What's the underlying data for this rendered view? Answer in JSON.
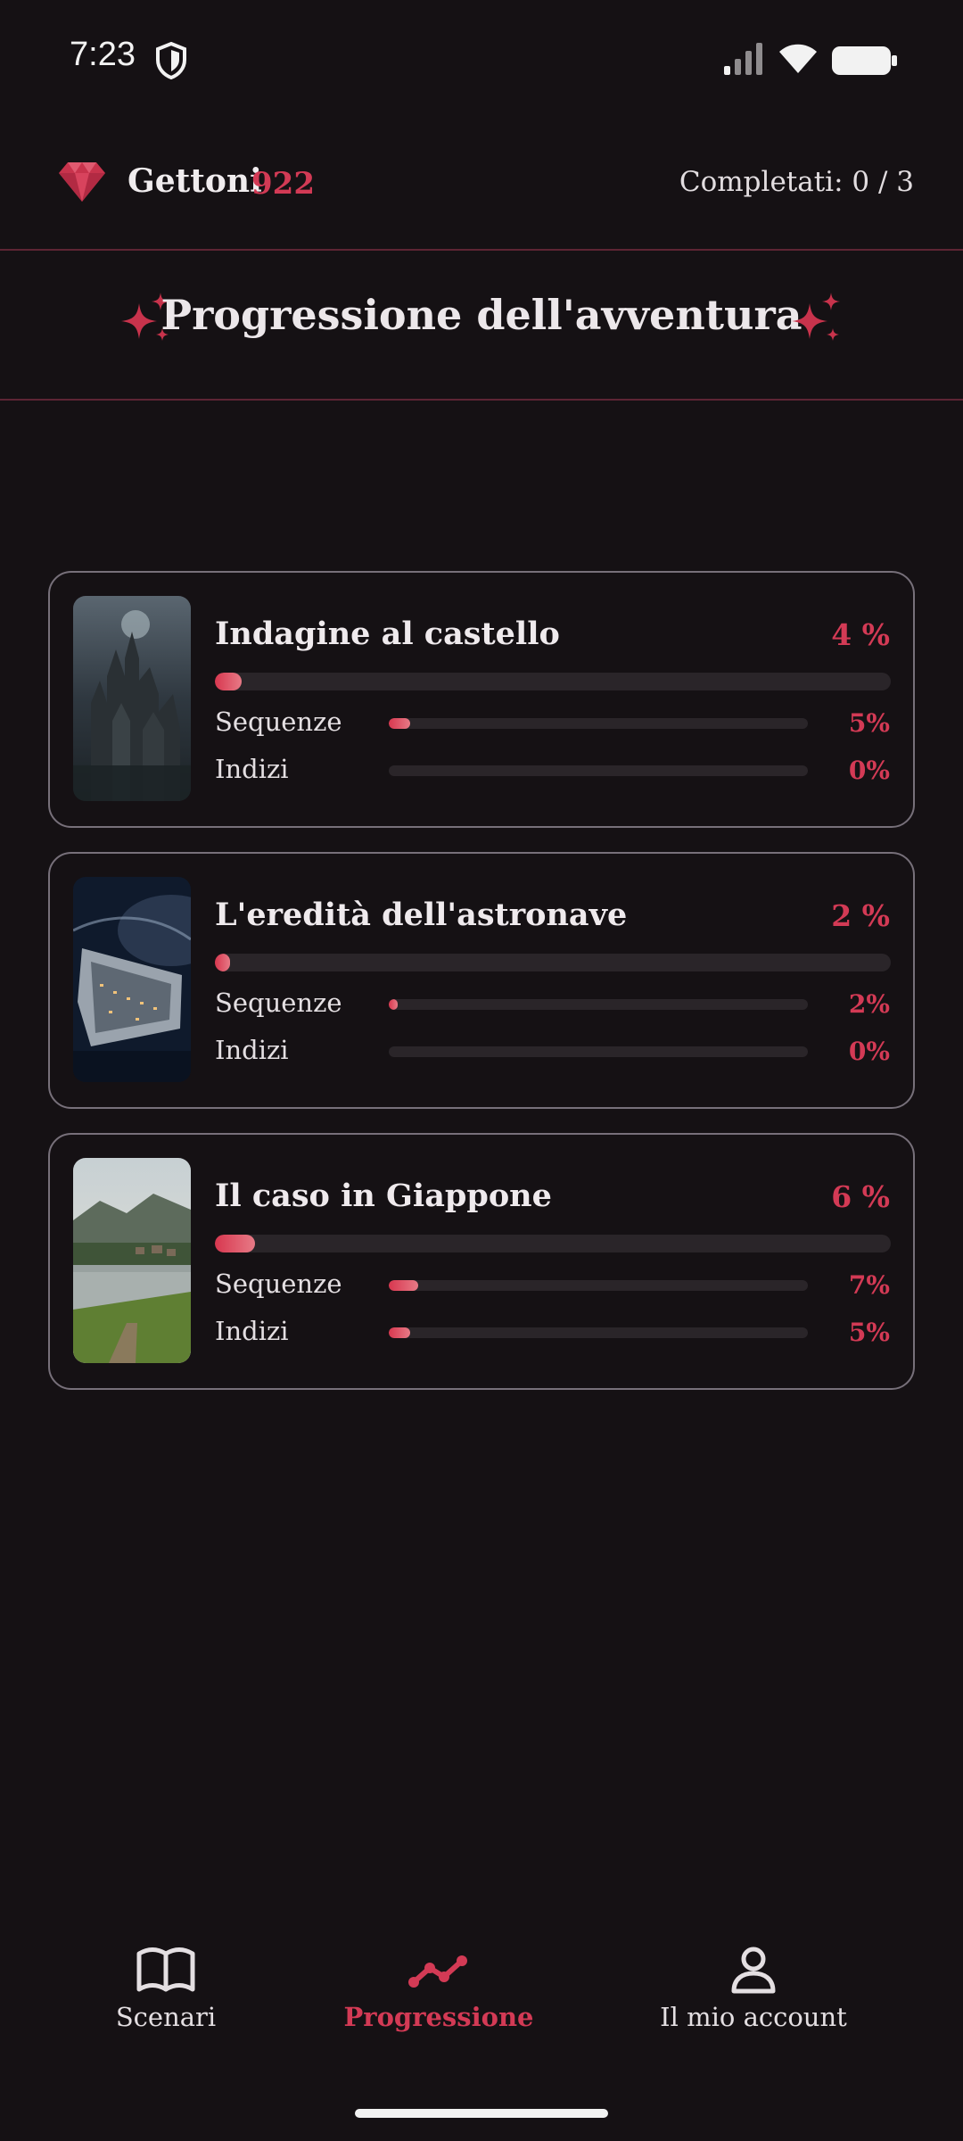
{
  "status_bar": {
    "time": "7:23",
    "icons": [
      "shield-icon",
      "signal-icon",
      "wifi-icon",
      "battery-icon"
    ]
  },
  "header": {
    "tokens_label": "Gettoni",
    "tokens_value": "922",
    "completed": "Completati: 0 / 3",
    "gem_icon": "gem-icon"
  },
  "title": {
    "text": "Progressione dell'avventura",
    "sparkle_icon": "sparkle-icon"
  },
  "theme": {
    "accent": "#d33a55",
    "background": "#151114",
    "card_border": "#77707a",
    "track": "#2a2529"
  },
  "scenarios": [
    {
      "title": "Indagine al castello",
      "percent_label": "4 %",
      "progress": 0.04,
      "thumbnail": "castle-image",
      "sequences": {
        "label": "Sequenze",
        "value": "5%",
        "progress": 0.05
      },
      "clues": {
        "label": "Indizi",
        "value": "0%",
        "progress": 0.0
      }
    },
    {
      "title": "L'eredità dell'astronave",
      "percent_label": "2 %",
      "progress": 0.02,
      "thumbnail": "spaceship-image",
      "sequences": {
        "label": "Sequenze",
        "value": "2%",
        "progress": 0.02
      },
      "clues": {
        "label": "Indizi",
        "value": "0%",
        "progress": 0.0
      }
    },
    {
      "title": "Il caso in Giappone",
      "percent_label": "6 %",
      "progress": 0.06,
      "thumbnail": "japan-lake-image",
      "sequences": {
        "label": "Sequenze",
        "value": "7%",
        "progress": 0.07
      },
      "clues": {
        "label": "Indizi",
        "value": "5%",
        "progress": 0.05
      }
    }
  ],
  "nav": {
    "items": [
      {
        "label": "Scenari",
        "icon": "book-icon",
        "active": false
      },
      {
        "label": "Progressione",
        "icon": "progress-chart-icon",
        "active": true
      },
      {
        "label": "Il mio account",
        "icon": "user-icon",
        "active": false
      }
    ]
  }
}
